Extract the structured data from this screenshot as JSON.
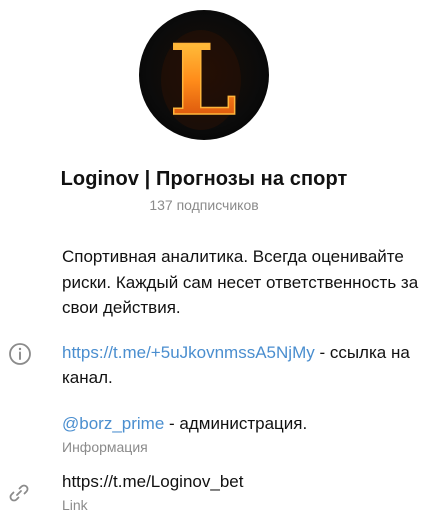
{
  "channel": {
    "title": "Loginov | Прогнозы на спорт",
    "subscribers": "137 подписчиков",
    "avatar_letter": "L",
    "description": "Спортивная аналитика. Всегда оценивайте риски. Каждый сам несет ответственность за свои действия."
  },
  "info": {
    "invite_link": "https://t.me/+5uJkovnmssA5NjMy",
    "invite_suffix": " - ссылка на канал.",
    "admin_handle": "@borz_prime",
    "admin_suffix": " - администрация.",
    "caption": "Информация"
  },
  "link": {
    "value": "https://t.me/Loginov_bet",
    "caption": "Link"
  },
  "colors": {
    "accent_link": "#4a8ecf",
    "secondary_text": "#8b8b8b"
  },
  "icons": [
    "info-icon",
    "link-icon"
  ]
}
